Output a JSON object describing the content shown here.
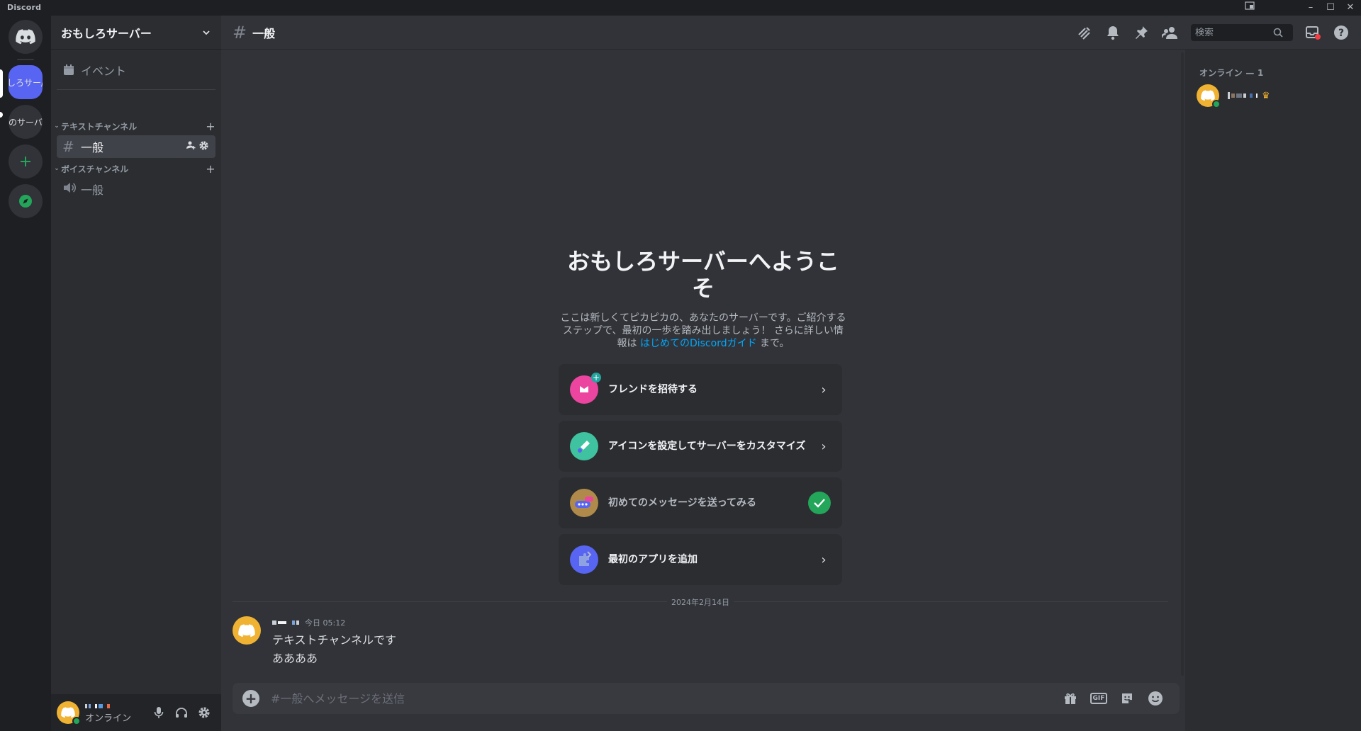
{
  "app": {
    "title": "Discord"
  },
  "window_controls": {
    "minimize": "–",
    "maximize": "☐",
    "close": "✕"
  },
  "servers": [
    {
      "label": "おもしろサーバー",
      "short": "しろサー/"
    },
    {
      "label": "サーバー",
      "short": "のサーバ"
    }
  ],
  "guild": {
    "name": "おもしろサーバー"
  },
  "sidebar": {
    "events_label": "イベント",
    "categories": [
      {
        "label": "テキストチャンネル",
        "channels": [
          {
            "label": "一般"
          }
        ]
      },
      {
        "label": "ボイスチャンネル",
        "channels": [
          {
            "label": "一般"
          }
        ]
      }
    ]
  },
  "user": {
    "status": "オンライン"
  },
  "header": {
    "channel": "一般",
    "search_placeholder": "検索"
  },
  "welcome": {
    "title": "おもしろサーバーへようこそ",
    "desc_before": "ここは新しくてピカピカの、あなたのサーバーです。ご紹介するステップで、最初の一歩を踏み出しましょう！ さらに詳しい情報は ",
    "link": "はじめてのDiscordガイド",
    "desc_after": " まで。",
    "cards": [
      {
        "label": "フレンドを招待する",
        "done": false
      },
      {
        "label": "アイコンを設定してサーバーをカスタマイズ",
        "done": false
      },
      {
        "label": "初めてのメッセージを送ってみる",
        "done": true
      },
      {
        "label": "最初のアプリを追加",
        "done": false
      }
    ]
  },
  "date_divider": "2024年2月14日",
  "message": {
    "time": "今日 05:12",
    "lines": [
      "テキストチャンネルです",
      "ああああ"
    ]
  },
  "composer": {
    "placeholder": "#一般へメッセージを送信",
    "gif_label": "GIF"
  },
  "members": {
    "header": "オンライン — 1"
  },
  "colors": {
    "accent": "#5865f2",
    "online": "#23a55a",
    "link": "#00a8fc",
    "avatar": "#f0b232"
  }
}
